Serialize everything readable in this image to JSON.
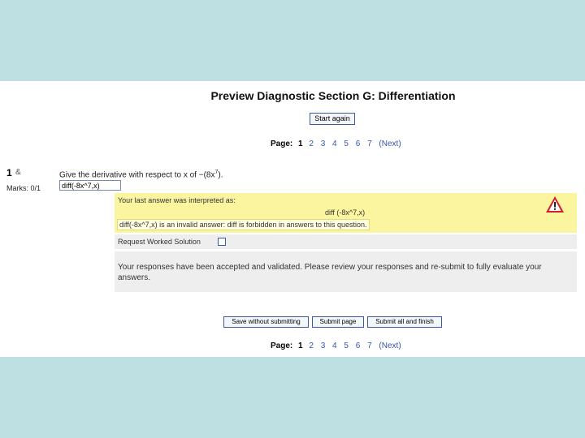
{
  "title": "Preview Diagnostic Section G: Differentiation",
  "start_again_label": "Start again",
  "pager_top": {
    "label": "Page:",
    "current": "1",
    "pages": [
      "2",
      "3",
      "4",
      "5",
      "6",
      "7"
    ],
    "next": "(Next)"
  },
  "pager_bottom": {
    "label": "Page:",
    "current": "1",
    "pages": [
      "2",
      "3",
      "4",
      "5",
      "6",
      "7"
    ],
    "next": "(Next)"
  },
  "question": {
    "number": "1",
    "flag": "&",
    "marks": "Marks: 0/1",
    "text_before": "Give the derivative with respect to x of −(8x",
    "exponent": "7",
    "text_after": ").",
    "answer_value": "diff(-8x^7,x)"
  },
  "feedback": {
    "interpreted_label": "Your last answer was interpreted as:",
    "interpreted_expr": "diff (-8x^7,x)",
    "error_text": "diff(-8x^7,x) is an invalid answer: diff is forbidden in answers to this question.",
    "warning_icon": "warning-triangle-icon"
  },
  "worked_solution_label": "Request Worked Solution",
  "validated_message": "Your responses have been accepted and validated. Please review your responses and re-submit to fully evaluate your answers.",
  "buttons": {
    "save_without_submitting": "Save without submitting",
    "submit_page": "Submit page",
    "submit_all_and_finish": "Submit all and finish"
  },
  "colors": {
    "page_bg": "#bfe0e3",
    "feedback_bg": "#fbf59f",
    "link": "#3355aa",
    "warning": "#d0202a"
  }
}
